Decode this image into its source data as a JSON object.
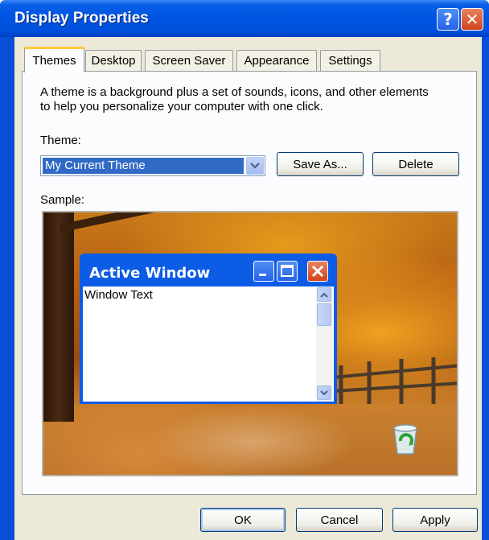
{
  "window": {
    "title": "Display Properties",
    "help_label": "?",
    "close_label": "✕"
  },
  "tabs": [
    {
      "label": "Themes"
    },
    {
      "label": "Desktop"
    },
    {
      "label": "Screen Saver"
    },
    {
      "label": "Appearance"
    },
    {
      "label": "Settings"
    }
  ],
  "themes": {
    "description_line1": "A theme is a background plus a set of sounds, icons, and other elements",
    "description_line2": "to help you personalize your computer with one click.",
    "theme_label": "Theme:",
    "theme_value": "My Current Theme",
    "save_as_label": "Save As...",
    "delete_label": "Delete",
    "sample_label": "Sample:"
  },
  "sample": {
    "active_window_title": "Active Window",
    "window_text": "Window Text"
  },
  "footer": {
    "ok_label": "OK",
    "cancel_label": "Cancel",
    "apply_label": "Apply"
  }
}
